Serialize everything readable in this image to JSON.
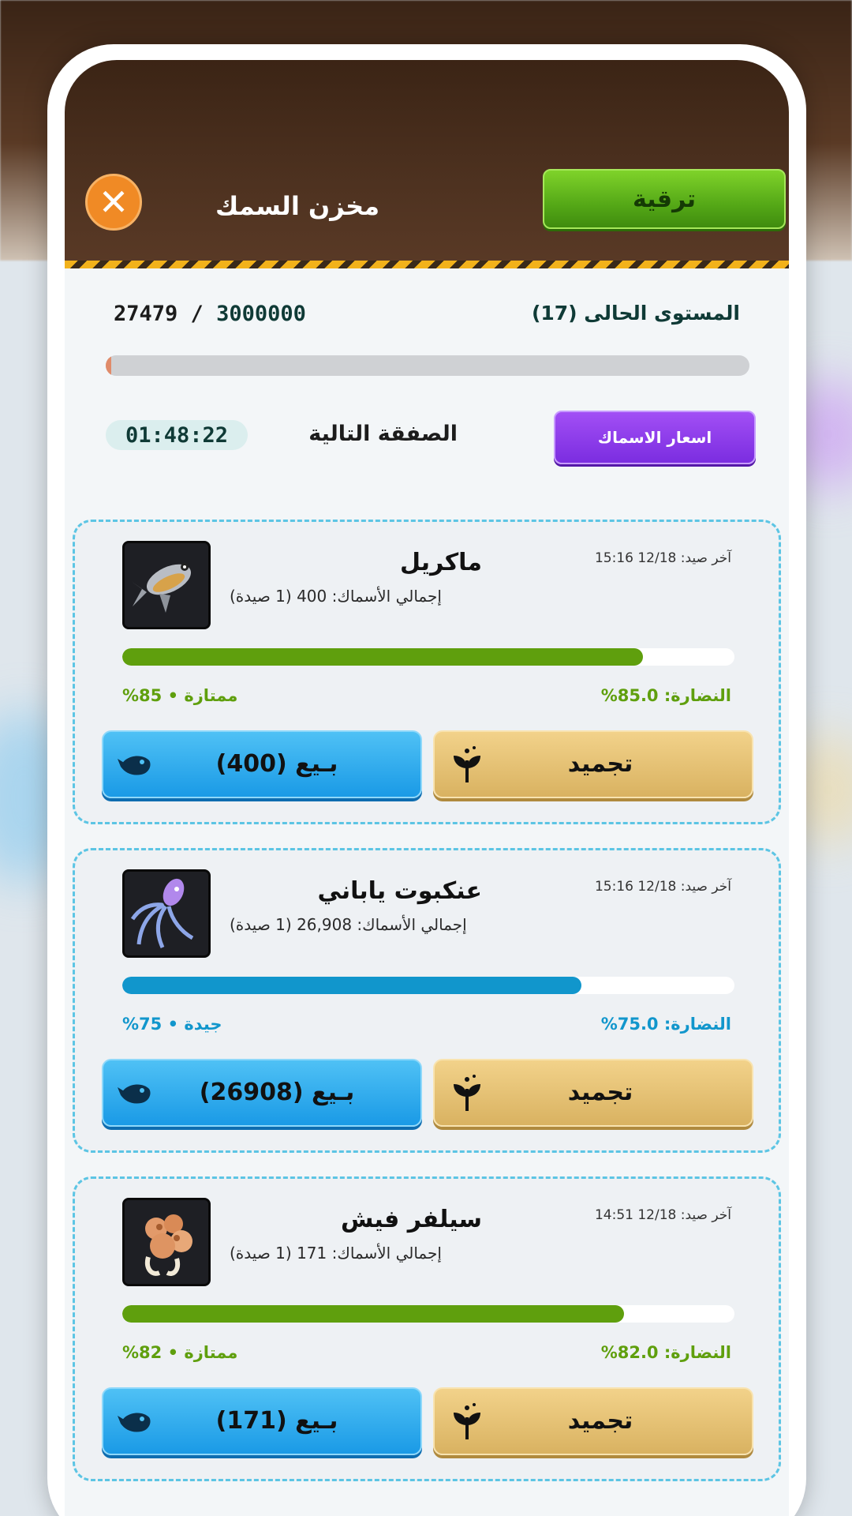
{
  "header": {
    "upgrade_label": "ترقية",
    "title": "مخزن السمك",
    "close_icon": "close-icon"
  },
  "storage": {
    "current": "27479",
    "separator": "/",
    "max": "3000000",
    "level_label": "المستوى الحالى (17)",
    "fill_fraction": 0.009
  },
  "deal": {
    "prices_button": "اسعار الاسماك",
    "next_label": "الصفقة التالية",
    "timer": "01:48:22"
  },
  "fishes": [
    {
      "name": "ماكريل",
      "total": "إجمالي الأسماك: 400 (1 صيدة)",
      "last_catch": "آخر صيد: 12/18 15:16",
      "freshness_label": "النضارة: 85.0%",
      "quality_label": "ممتازة • 85%",
      "freshness_value": 0.85,
      "bar_color": "#5f9f0d",
      "label_color": "#5f9f0d",
      "sell_label": "بـيع (400)",
      "freeze_label": "تجميد",
      "thumb_icon": "mackerel-fish-icon"
    },
    {
      "name": "عنكبوت ياباني",
      "total": "إجمالي الأسماك: 26,908 (1 صيدة)",
      "last_catch": "آخر صيد: 12/18 15:16",
      "freshness_label": "النضارة: 75.0%",
      "quality_label": "جيدة • 75%",
      "freshness_value": 0.75,
      "bar_color": "#1196cc",
      "label_color": "#1196cc",
      "sell_label": "بـيع (26908)",
      "freeze_label": "تجميد",
      "thumb_icon": "squid-icon"
    },
    {
      "name": "سيلفر فيش",
      "total": "إجمالي الأسماك: 171 (1 صيدة)",
      "last_catch": "آخر صيد: 12/18 14:51",
      "freshness_label": "النضارة: 82.0%",
      "quality_label": "ممتازة • 82%",
      "freshness_value": 0.82,
      "bar_color": "#5f9f0d",
      "label_color": "#5f9f0d",
      "sell_label": "بـيع (171)",
      "freeze_label": "تجميد",
      "thumb_icon": "coral-crab-icon"
    }
  ],
  "colors": {
    "header_bg": "#3b2415",
    "upgrade_green": "#55a817",
    "close_orange": "#f08a25",
    "prices_purple": "#7b2de0",
    "sell_blue": "#1a9ae6",
    "freeze_gold": "#d9b261",
    "card_border": "#5cc5e4"
  }
}
